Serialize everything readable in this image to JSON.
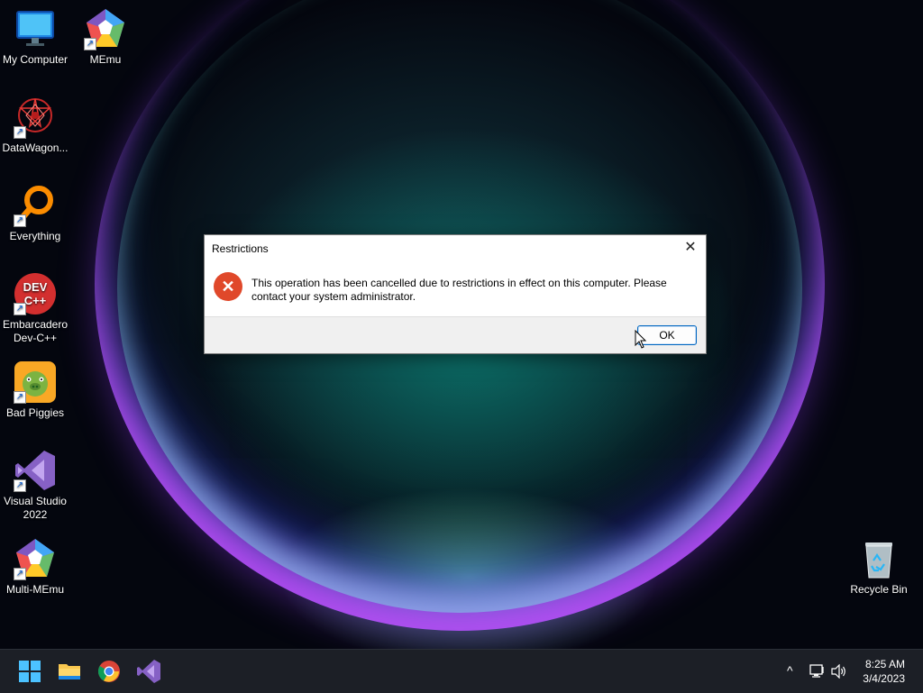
{
  "desktop": {
    "icons": [
      {
        "label": "My Computer"
      },
      {
        "label": "MEmu"
      },
      {
        "label": "DataWagon..."
      },
      {
        "label": "Everything"
      },
      {
        "label": "Embarcadero Dev-C++"
      },
      {
        "label": "Bad Piggies"
      },
      {
        "label": "Visual Studio 2022"
      },
      {
        "label": "Multi-MEmu"
      },
      {
        "label": "Recycle Bin"
      }
    ],
    "devcpp_text": "DEV C++"
  },
  "dialog": {
    "title": "Restrictions",
    "close_glyph": "✕",
    "message": "This operation has been cancelled due to restrictions in effect on this computer. Please contact your system administrator.",
    "ok_label": "OK",
    "icon": "error-icon",
    "icon_glyph": "✕"
  },
  "taskbar": {
    "pinned": [
      "start-icon",
      "file-explorer-icon",
      "chrome-icon",
      "visual-studio-icon"
    ],
    "tray_chevron": "^",
    "time": "8:25 AM",
    "date": "3/4/2023"
  },
  "colors": {
    "accent": "#0067c0",
    "error": "#e0482a",
    "taskbar": "#1c1f26"
  }
}
